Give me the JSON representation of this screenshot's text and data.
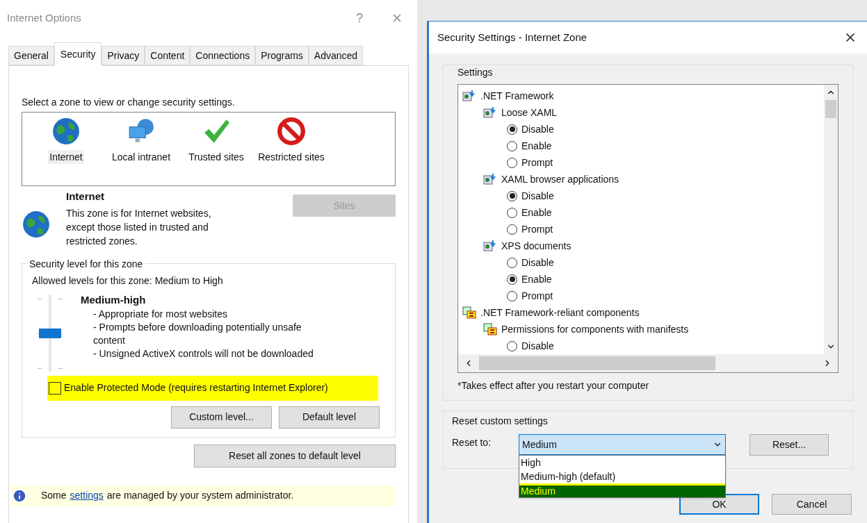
{
  "internet_options": {
    "title": "Internet Options",
    "help": "?",
    "tabs": [
      {
        "label": "General",
        "selected": false
      },
      {
        "label": "Security",
        "selected": true
      },
      {
        "label": "Privacy",
        "selected": false
      },
      {
        "label": "Content",
        "selected": false
      },
      {
        "label": "Connections",
        "selected": false
      },
      {
        "label": "Programs",
        "selected": false
      },
      {
        "label": "Advanced",
        "selected": false
      }
    ],
    "zone_prompt": "Select a zone to view or change security settings.",
    "zones": [
      {
        "kind": "globe",
        "label": "Internet",
        "selected": true
      },
      {
        "kind": "intranet",
        "label": "Local intranet",
        "selected": false
      },
      {
        "kind": "check",
        "label": "Trusted sites",
        "selected": false
      },
      {
        "kind": "restricted",
        "label": "Restricted sites",
        "selected": false
      }
    ],
    "zone_info": {
      "name": "Internet",
      "description": "This zone is for Internet websites, except those listed in trusted and restricted zones."
    },
    "sites_button": {
      "label": "Sites",
      "disabled": true
    },
    "security_level": {
      "legend": "Security level for this zone",
      "allowed": "Allowed levels for this zone: Medium to High",
      "level": 0.5,
      "level_name": "Medium-high",
      "details": [
        "- Appropriate for most websites",
        "- Prompts before downloading potentially unsafe content",
        "- Unsigned ActiveX controls will not be downloaded"
      ],
      "protected_mode": {
        "label": "Enable Protected Mode (requires restarting Internet Explorer)",
        "checked": false
      },
      "buttons": [
        "Custom level...",
        "Default level"
      ]
    },
    "reset_all_button": "Reset all zones to default level",
    "info_bar": {
      "before": "Some",
      "link": "settings",
      "after": "are managed by your system administrator."
    }
  },
  "security_settings": {
    "title": "Security Settings - Internet Zone",
    "settings_legend": "Settings",
    "tree": [
      {
        "kind": "framework",
        "label": ".NET Framework",
        "children": [
          {
            "kind": "framework",
            "label": "Loose XAML",
            "options": [
              {
                "label": "Disable",
                "selected": true
              },
              {
                "label": "Enable",
                "selected": false
              },
              {
                "label": "Prompt",
                "selected": false
              }
            ]
          },
          {
            "kind": "framework",
            "label": "XAML browser applications",
            "options": [
              {
                "label": "Disable",
                "selected": true
              },
              {
                "label": "Enable",
                "selected": false
              },
              {
                "label": "Prompt",
                "selected": false
              }
            ]
          },
          {
            "kind": "framework",
            "label": "XPS documents",
            "options": [
              {
                "label": "Disable",
                "selected": false
              },
              {
                "label": "Enable",
                "selected": true
              },
              {
                "label": "Prompt",
                "selected": false
              }
            ]
          }
        ]
      },
      {
        "kind": "components",
        "label": ".NET Framework-reliant components",
        "children": [
          {
            "kind": "components",
            "label": "Permissions for components with manifests",
            "options": [
              {
                "label": "Disable",
                "selected": false
              }
            ]
          }
        ]
      }
    ],
    "footnote": "*Takes effect after you restart your computer",
    "reset_group": {
      "legend": "Reset custom settings",
      "label": "Reset to:",
      "value": "Medium",
      "options": [
        {
          "label": "High",
          "selected": false
        },
        {
          "label": "Medium-high (default)",
          "selected": false
        },
        {
          "label": "Medium",
          "selected": true
        }
      ],
      "reset_button": "Reset..."
    },
    "buttons": [
      "OK",
      "Cancel"
    ]
  }
}
